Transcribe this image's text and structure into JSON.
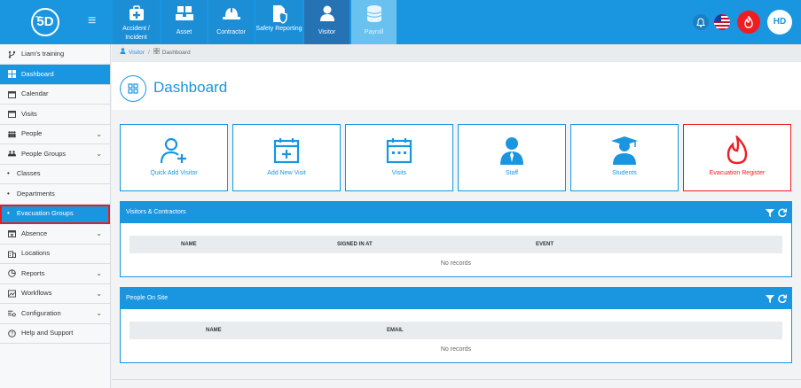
{
  "brand": {
    "logo_text": "5D",
    "logo_small": "PEO"
  },
  "modules": [
    {
      "label": "Accident / Incident",
      "icon": "first-aid-icon"
    },
    {
      "label": "Asset",
      "icon": "boxes-icon"
    },
    {
      "label": "Contractor",
      "icon": "hard-hat-icon"
    },
    {
      "label": "Safety Reporting",
      "icon": "safety-report-icon"
    },
    {
      "label": "Visitor",
      "icon": "visitor-icon"
    },
    {
      "label": "Payroll",
      "icon": "coins-icon"
    }
  ],
  "user": {
    "initials": "HD"
  },
  "sidebar": {
    "org": "Liam's training",
    "items": [
      {
        "label": "Dashboard",
        "icon": "dashboard-icon"
      },
      {
        "label": "Calendar",
        "icon": "calendar-icon"
      },
      {
        "label": "Visits",
        "icon": "calendar-icon"
      },
      {
        "label": "People",
        "icon": "people-icon"
      },
      {
        "label": "People Groups",
        "icon": "people-groups-icon"
      },
      {
        "label": "Classes"
      },
      {
        "label": "Departments"
      },
      {
        "label": "Evacuation Groups"
      },
      {
        "label": "Absence",
        "icon": "absence-icon"
      },
      {
        "label": "Locations",
        "icon": "locations-icon"
      },
      {
        "label": "Reports",
        "icon": "reports-icon"
      },
      {
        "label": "Workflows",
        "icon": "workflows-icon"
      },
      {
        "label": "Configuration",
        "icon": "configuration-icon"
      },
      {
        "label": "Help and Support",
        "icon": "help-icon"
      }
    ]
  },
  "breadcrumb": {
    "parent": "Visitor",
    "separator": "/",
    "current": "Dashboard"
  },
  "page": {
    "title": "Dashboard"
  },
  "tiles": [
    {
      "label": "Quick Add Visitor",
      "icon": "add-user-icon"
    },
    {
      "label": "Add New Visit",
      "icon": "calendar-plus-icon"
    },
    {
      "label": "Visits",
      "icon": "calendar-icon"
    },
    {
      "label": "Staff",
      "icon": "staff-icon"
    },
    {
      "label": "Students",
      "icon": "graduate-icon"
    },
    {
      "label": "Evacuation Register",
      "icon": "fire-icon"
    }
  ],
  "panels": {
    "visitors": {
      "title": "Visitors & Contractors",
      "columns": [
        "NAME",
        "SIGNED IN AT",
        "EVENT"
      ],
      "empty": "No records"
    },
    "people": {
      "title": "People On Site",
      "columns": [
        "NAME",
        "EMAIL"
      ],
      "empty": "No records"
    }
  },
  "colors": {
    "primary": "#1a96e0",
    "active_module": "#2572b5",
    "danger": "#ef1d22",
    "highlight_border": "#e02020"
  }
}
